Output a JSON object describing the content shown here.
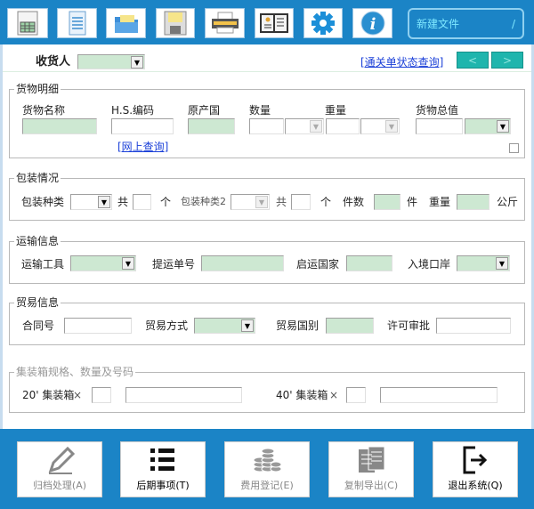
{
  "toolbar": {
    "icons": [
      "spreadsheet-icon",
      "document-icon",
      "folder-icon",
      "save-icon",
      "print-icon",
      "book-icon",
      "gear-icon",
      "info-icon"
    ],
    "file_name": "新建文件",
    "file_counter": "/"
  },
  "header": {
    "consignee_label": "收货人",
    "status_link": "[通关单状态查询]",
    "prev": "<",
    "next": ">"
  },
  "goods": {
    "legend": "货物明细",
    "name": "货物名称",
    "hs": "H.S.编码",
    "origin": "原产国",
    "qty": "数量",
    "weight": "重量",
    "value": "货物总值",
    "online_link": "[网上查询]"
  },
  "packing": {
    "legend": "包装情况",
    "type1": "包装种类",
    "total1": "共",
    "unit1": "个",
    "type2": "包装种类2",
    "total2": "共",
    "unit2": "个",
    "pieces": "件数",
    "pieces_unit": "件",
    "weight": "重量",
    "weight_unit": "公斤"
  },
  "transport": {
    "legend": "运输信息",
    "vehicle": "运输工具",
    "bill": "提运单号",
    "departure": "启运国家",
    "port": "入境口岸"
  },
  "trade": {
    "legend": "贸易信息",
    "contract": "合同号",
    "mode": "贸易方式",
    "country": "贸易国别",
    "license": "许可审批"
  },
  "container": {
    "legend": "集装箱规格、数量及号码",
    "c20": "20' 集装箱",
    "c40": "40' 集装箱",
    "times": "×"
  },
  "actions": [
    {
      "label": "归档处理(A)",
      "icon": "pencil-icon",
      "enabled": false
    },
    {
      "label": "后期事项(T)",
      "icon": "list-icon",
      "enabled": true
    },
    {
      "label": "费用登记(E)",
      "icon": "coins-icon",
      "enabled": false
    },
    {
      "label": "复制导出(C)",
      "icon": "copy-documents-icon",
      "enabled": false
    },
    {
      "label": "退出系统(Q)",
      "icon": "exit-icon",
      "enabled": true
    }
  ]
}
